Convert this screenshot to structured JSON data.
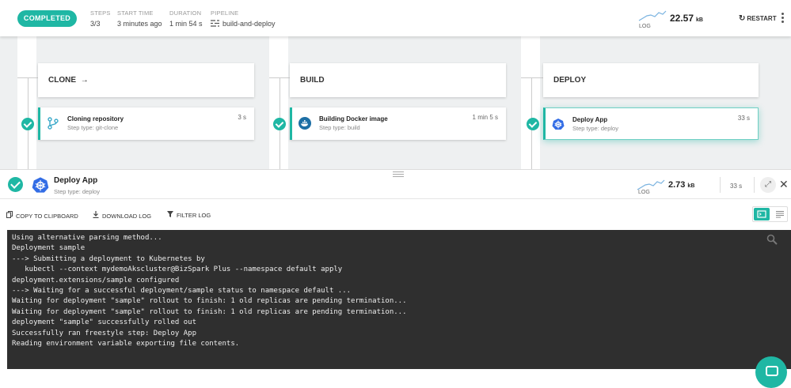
{
  "topbar": {
    "status": "COMPLETED",
    "steps_label": "STEPS",
    "steps_value": "3/3",
    "start_label": "START TIME",
    "start_value": "3 minutes ago",
    "duration_label": "DURATION",
    "duration_value": "1 min 54 s",
    "pipeline_label": "PIPELINE",
    "pipeline_value": "build-and-deploy",
    "log_label": "LOG",
    "log_size": "22.57",
    "log_unit": "kB",
    "restart_label": "RESTART"
  },
  "stages": [
    {
      "name": "CLONE",
      "arrow": "→",
      "step_title": "Cloning repository",
      "step_sub": "Step type: git-clone",
      "step_time": "3 s",
      "icon": "git-branch-icon"
    },
    {
      "name": "BUILD",
      "arrow": "",
      "step_title": "Building Docker image",
      "step_sub": "Step type: build",
      "step_time": "1 min 5 s",
      "icon": "docker-icon"
    },
    {
      "name": "DEPLOY",
      "arrow": "",
      "step_title": "Deploy App",
      "step_sub": "Step type: deploy",
      "step_time": "33 s",
      "icon": "kubernetes-icon"
    }
  ],
  "drawer": {
    "title": "Deploy App",
    "subtitle": "Step type: deploy",
    "log_label": "LOG",
    "log_size": "2.73",
    "log_unit": "kB",
    "time": "33 s"
  },
  "toolbar": {
    "copy": "COPY TO CLIPBOARD",
    "download": "DOWNLOAD LOG",
    "filter": "FILTER LOG"
  },
  "log_lines": [
    "Using alternative parsing method...",
    "Deployment sample",
    "---> Submitting a deployment to Kubernetes by",
    "   kubectl --context mydemoAkscluster@BizSpark Plus --namespace default apply",
    "deployment.extensions/sample configured",
    "---> Waiting for a successful deployment/sample status to namespace default ...",
    "Waiting for deployment \"sample\" rollout to finish: 1 old replicas are pending termination...",
    "Waiting for deployment \"sample\" rollout to finish: 1 old replicas are pending termination...",
    "deployment \"sample\" successfully rolled out",
    "Successfully ran freestyle step: Deploy App",
    "Reading environment variable exporting file contents."
  ],
  "colors": {
    "accent": "#1fb7a4",
    "terminal_bg": "#2f2f2f",
    "stage_bg": "#eef0f1"
  }
}
